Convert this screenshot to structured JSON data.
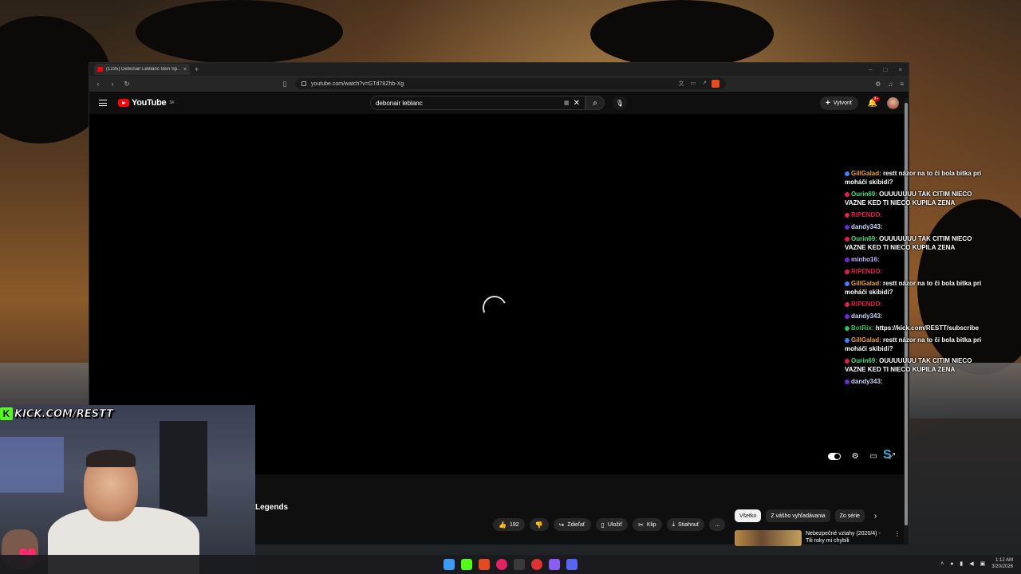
{
  "browser": {
    "tab_title": "(1235) Debonair LeBlanc Skin Sp...",
    "new_tab": "+",
    "close_tab": "×",
    "window_controls": [
      "–",
      "□",
      "×"
    ],
    "url": "youtube.com/watch?v=GTd78Zhb-Xg"
  },
  "youtube": {
    "logo_text": "YouTube",
    "country_code": "SK",
    "search_value": "debonair leblanc",
    "create_label": "Vytvoriť",
    "notifications_badge": "9+",
    "video_title": "Legends",
    "actions": {
      "like_count": "192",
      "share": "Zdieľať",
      "save": "Uložiť",
      "clip": "Klip",
      "download": "Stiahnuť",
      "more": "..."
    },
    "chips": [
      "Všetko",
      "Z vášho vyhľadávania",
      "Zo série"
    ],
    "recommendation_title": "Nebezpečné vztahy (2020/4) - Tili roky mi chybili"
  },
  "chat": [
    {
      "user": "GillGalad:",
      "text": "restt názor na to či bola bitka pri moháči skibidi?",
      "color": "#f0a030",
      "badge": "#3b82f6"
    },
    {
      "user": "Ourin69:",
      "text": "OUUUUUUU TAK CITIM NIECO VAZNE KED TI NIECO KUPILA ZENA",
      "color": "#4ade80",
      "badge": "#e11d48"
    },
    {
      "user": "RIPENDO:",
      "text": "",
      "color": "#e11d48",
      "badge": "#e11d48"
    },
    {
      "user": "dandy343:",
      "text": "",
      "color": "#c7d2fe",
      "badge": "#6d28d9"
    },
    {
      "user": "Ourin69:",
      "text": "OUUUUUUU TAK CITIM NIECO VAZNE KED TI NIECO KUPILA ZENA",
      "color": "#4ade80",
      "badge": "#e11d48"
    },
    {
      "user": "minho16:",
      "text": "",
      "color": "#c4b5fd",
      "badge": "#6d28d9"
    },
    {
      "user": "RIPENDO:",
      "text": "",
      "color": "#e11d48",
      "badge": "#e11d48"
    },
    {
      "user": "GillGalad:",
      "text": "restt názor na to či bola bitka pri moháči skibidi?",
      "color": "#f0a030",
      "badge": "#3b82f6"
    },
    {
      "user": "RIPENDO:",
      "text": "",
      "color": "#e11d48",
      "badge": "#e11d48"
    },
    {
      "user": "dandy343:",
      "text": "",
      "color": "#c7d2fe",
      "badge": "#6d28d9"
    },
    {
      "user": "BotRix:",
      "text": "https://kick.com/RESTT/subscribe",
      "color": "#22c55e",
      "badge": "#22c55e"
    },
    {
      "user": "GillGalad:",
      "text": "restt názor na to či bola bitka pri moháči skibidi?",
      "color": "#f0a030",
      "badge": "#3b82f6"
    },
    {
      "user": "Ourin69:",
      "text": "OUUUUUUU TAK CITIM NIECO VAZNE KED TI NIECO KUPILA ZENA",
      "color": "#4ade80",
      "badge": "#e11d48"
    },
    {
      "user": "dandy343:",
      "text": "",
      "color": "#c7d2fe",
      "badge": "#6d28d9"
    }
  ],
  "overlay": {
    "kick_text": "KICK.COM/RESTT",
    "kick_letter": "K"
  },
  "taskbar": {
    "time": "1:12 AM",
    "date": "3/20/2026"
  },
  "colors": {
    "youtube_red": "#ff0000",
    "kick_green": "#53fc18"
  }
}
